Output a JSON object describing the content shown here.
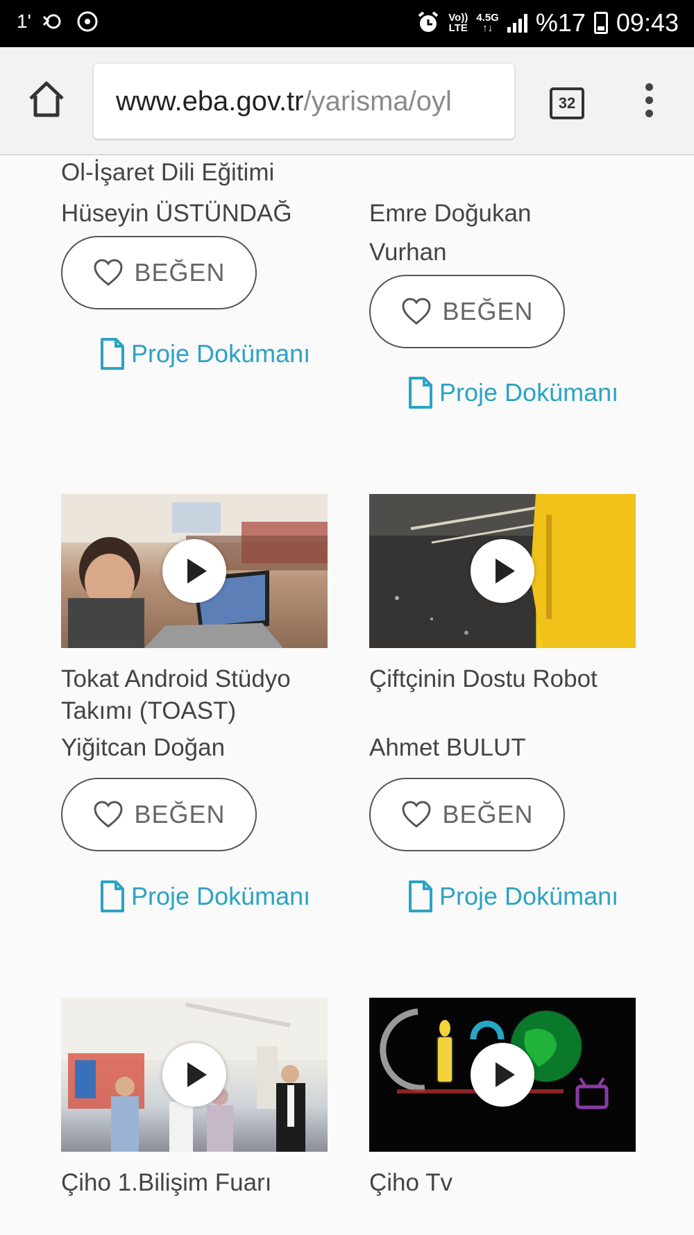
{
  "status_bar": {
    "left_badge": "1'",
    "network_top": "Vo))",
    "network_bottom": "LTE",
    "data_top": "4.5G",
    "data_bottom": "↑↓",
    "battery": "%17",
    "time": "09:43"
  },
  "browser": {
    "url_domain": "www.eba.gov.tr",
    "url_path": "/yarisma/oyl",
    "tab_count": "32"
  },
  "projects": [
    {
      "title": "Ol-İşaret Dili Eğitimi",
      "author": "Hüseyin ÜSTÜNDAĞ",
      "like_label": "BEĞEN",
      "doc_label": "Proje Dokümanı"
    },
    {
      "title": "",
      "author": "Emre Doğukan Vurhan",
      "like_label": "BEĞEN",
      "doc_label": "Proje Dokümanı"
    },
    {
      "title": "Tokat Android Stüdyo Takımı (TOAST)",
      "author": "Yiğitcan Doğan",
      "like_label": "BEĞEN",
      "doc_label": "Proje Dokümanı"
    },
    {
      "title": "Çiftçinin Dostu Robot",
      "author": "Ahmet BULUT",
      "like_label": "BEĞEN",
      "doc_label": "Proje Dokümanı"
    },
    {
      "title": "Çiho 1.Bilişim Fuarı"
    },
    {
      "title": "Çiho Tv"
    }
  ],
  "icons": {
    "home": "home-icon",
    "menu": "more-vert-icon",
    "heart": "heart-outline-icon",
    "document": "document-icon",
    "play": "play-icon"
  },
  "colors": {
    "link": "#2aa3c4",
    "status_bar": "#000000",
    "toolbar": "#f2f2f2"
  }
}
